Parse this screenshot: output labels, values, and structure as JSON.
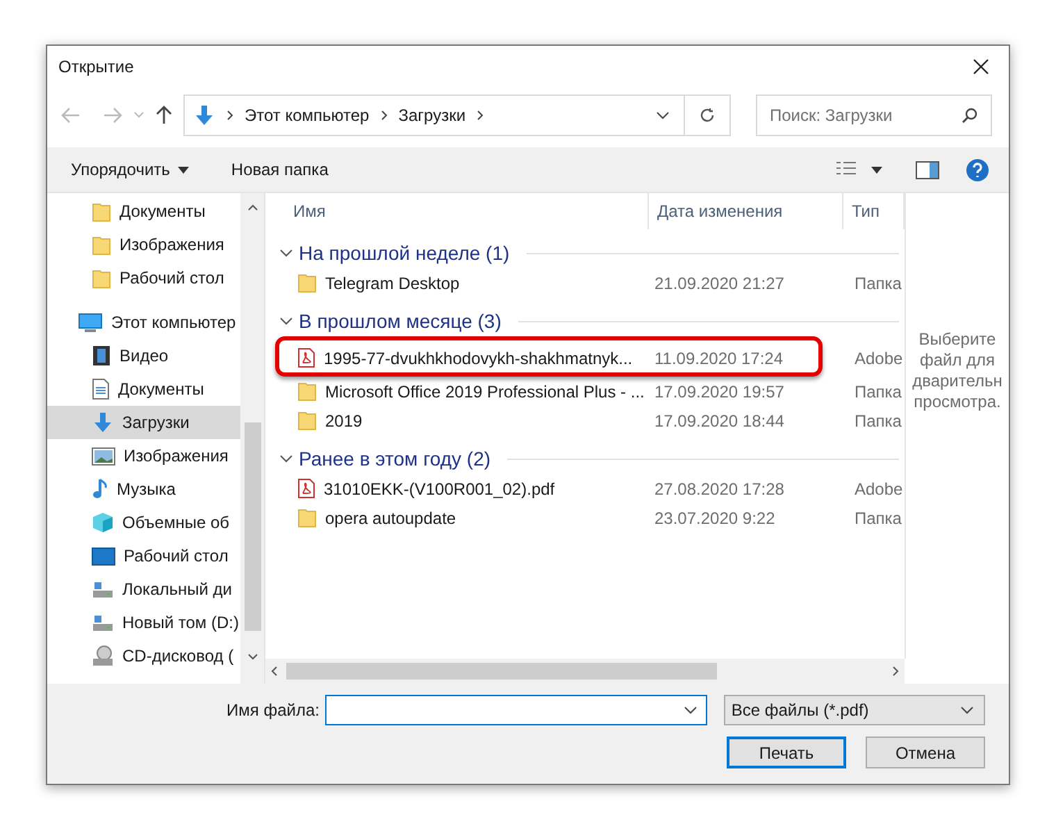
{
  "window": {
    "title": "Открытие"
  },
  "address": {
    "crumbs": [
      "Этот компьютер",
      "Загрузки"
    ]
  },
  "search": {
    "placeholder": "Поиск: Загрузки"
  },
  "toolbar": {
    "organize": "Упорядочить",
    "new_folder": "Новая папка"
  },
  "sidebar": {
    "items": [
      {
        "label": "Документы",
        "kind": "folder",
        "selected": false
      },
      {
        "label": "Изображения",
        "kind": "folder",
        "selected": false
      },
      {
        "label": "Рабочий стол",
        "kind": "folder",
        "selected": false
      },
      {
        "label": "Этот компьютер",
        "kind": "computer",
        "selected": false,
        "children": [
          {
            "label": "Видео",
            "kind": "video",
            "selected": false
          },
          {
            "label": "Документы",
            "kind": "documents",
            "selected": false
          },
          {
            "label": "Загрузки",
            "kind": "downloads",
            "selected": true
          },
          {
            "label": "Изображения",
            "kind": "pictures",
            "selected": false
          },
          {
            "label": "Музыка",
            "kind": "music",
            "selected": false
          },
          {
            "label": "Объемные об",
            "kind": "cube",
            "selected": false
          },
          {
            "label": "Рабочий стол",
            "kind": "desktop",
            "selected": false
          },
          {
            "label": "Локальный ди",
            "kind": "drive",
            "selected": false
          },
          {
            "label": "Новый том (D:)",
            "kind": "drive",
            "selected": false
          },
          {
            "label": "CD-дисковод (",
            "kind": "cd",
            "selected": false
          }
        ]
      }
    ]
  },
  "table": {
    "columns": [
      "Имя",
      "Дата изменения",
      "Тип"
    ],
    "groups": [
      {
        "title": "На прошлой неделе (1)",
        "expanded": true,
        "rows": [
          {
            "name": "Telegram Desktop",
            "date": "21.09.2020 21:27",
            "type": "Папка",
            "kind": "folder",
            "highlighted": false
          }
        ]
      },
      {
        "title": "В прошлом месяце (3)",
        "expanded": true,
        "rows": [
          {
            "name": "1995-77-dvukhkhodovykh-shakhmatnyk...",
            "date": "11.09.2020 17:24",
            "type": "Adobe",
            "kind": "pdf",
            "highlighted": true
          },
          {
            "name": "Microsoft Office 2019 Professional Plus - ...",
            "date": "17.09.2020 19:57",
            "type": "Папка",
            "kind": "folder",
            "highlighted": false
          },
          {
            "name": "2019",
            "date": "17.09.2020 18:44",
            "type": "Папка",
            "kind": "folder",
            "highlighted": false
          }
        ]
      },
      {
        "title": "Ранее в этом году (2)",
        "expanded": true,
        "rows": [
          {
            "name": "31010EKK-(V100R001_02).pdf",
            "date": "27.08.2020 17:28",
            "type": "Adobe",
            "kind": "pdf",
            "highlighted": false
          },
          {
            "name": "opera autoupdate",
            "date": "23.07.2020 9:22",
            "type": "Папка",
            "kind": "folder",
            "highlighted": false
          }
        ]
      }
    ]
  },
  "preview": {
    "lines": [
      "Выберите",
      "файл для",
      "дварительн",
      "просмотра."
    ]
  },
  "filename": {
    "label": "Имя файла:"
  },
  "filter": {
    "value": "Все файлы (*.pdf)"
  },
  "buttons": [
    {
      "label": "Печать",
      "kind": "default"
    },
    {
      "label": "Отмена",
      "kind": "normal"
    }
  ]
}
